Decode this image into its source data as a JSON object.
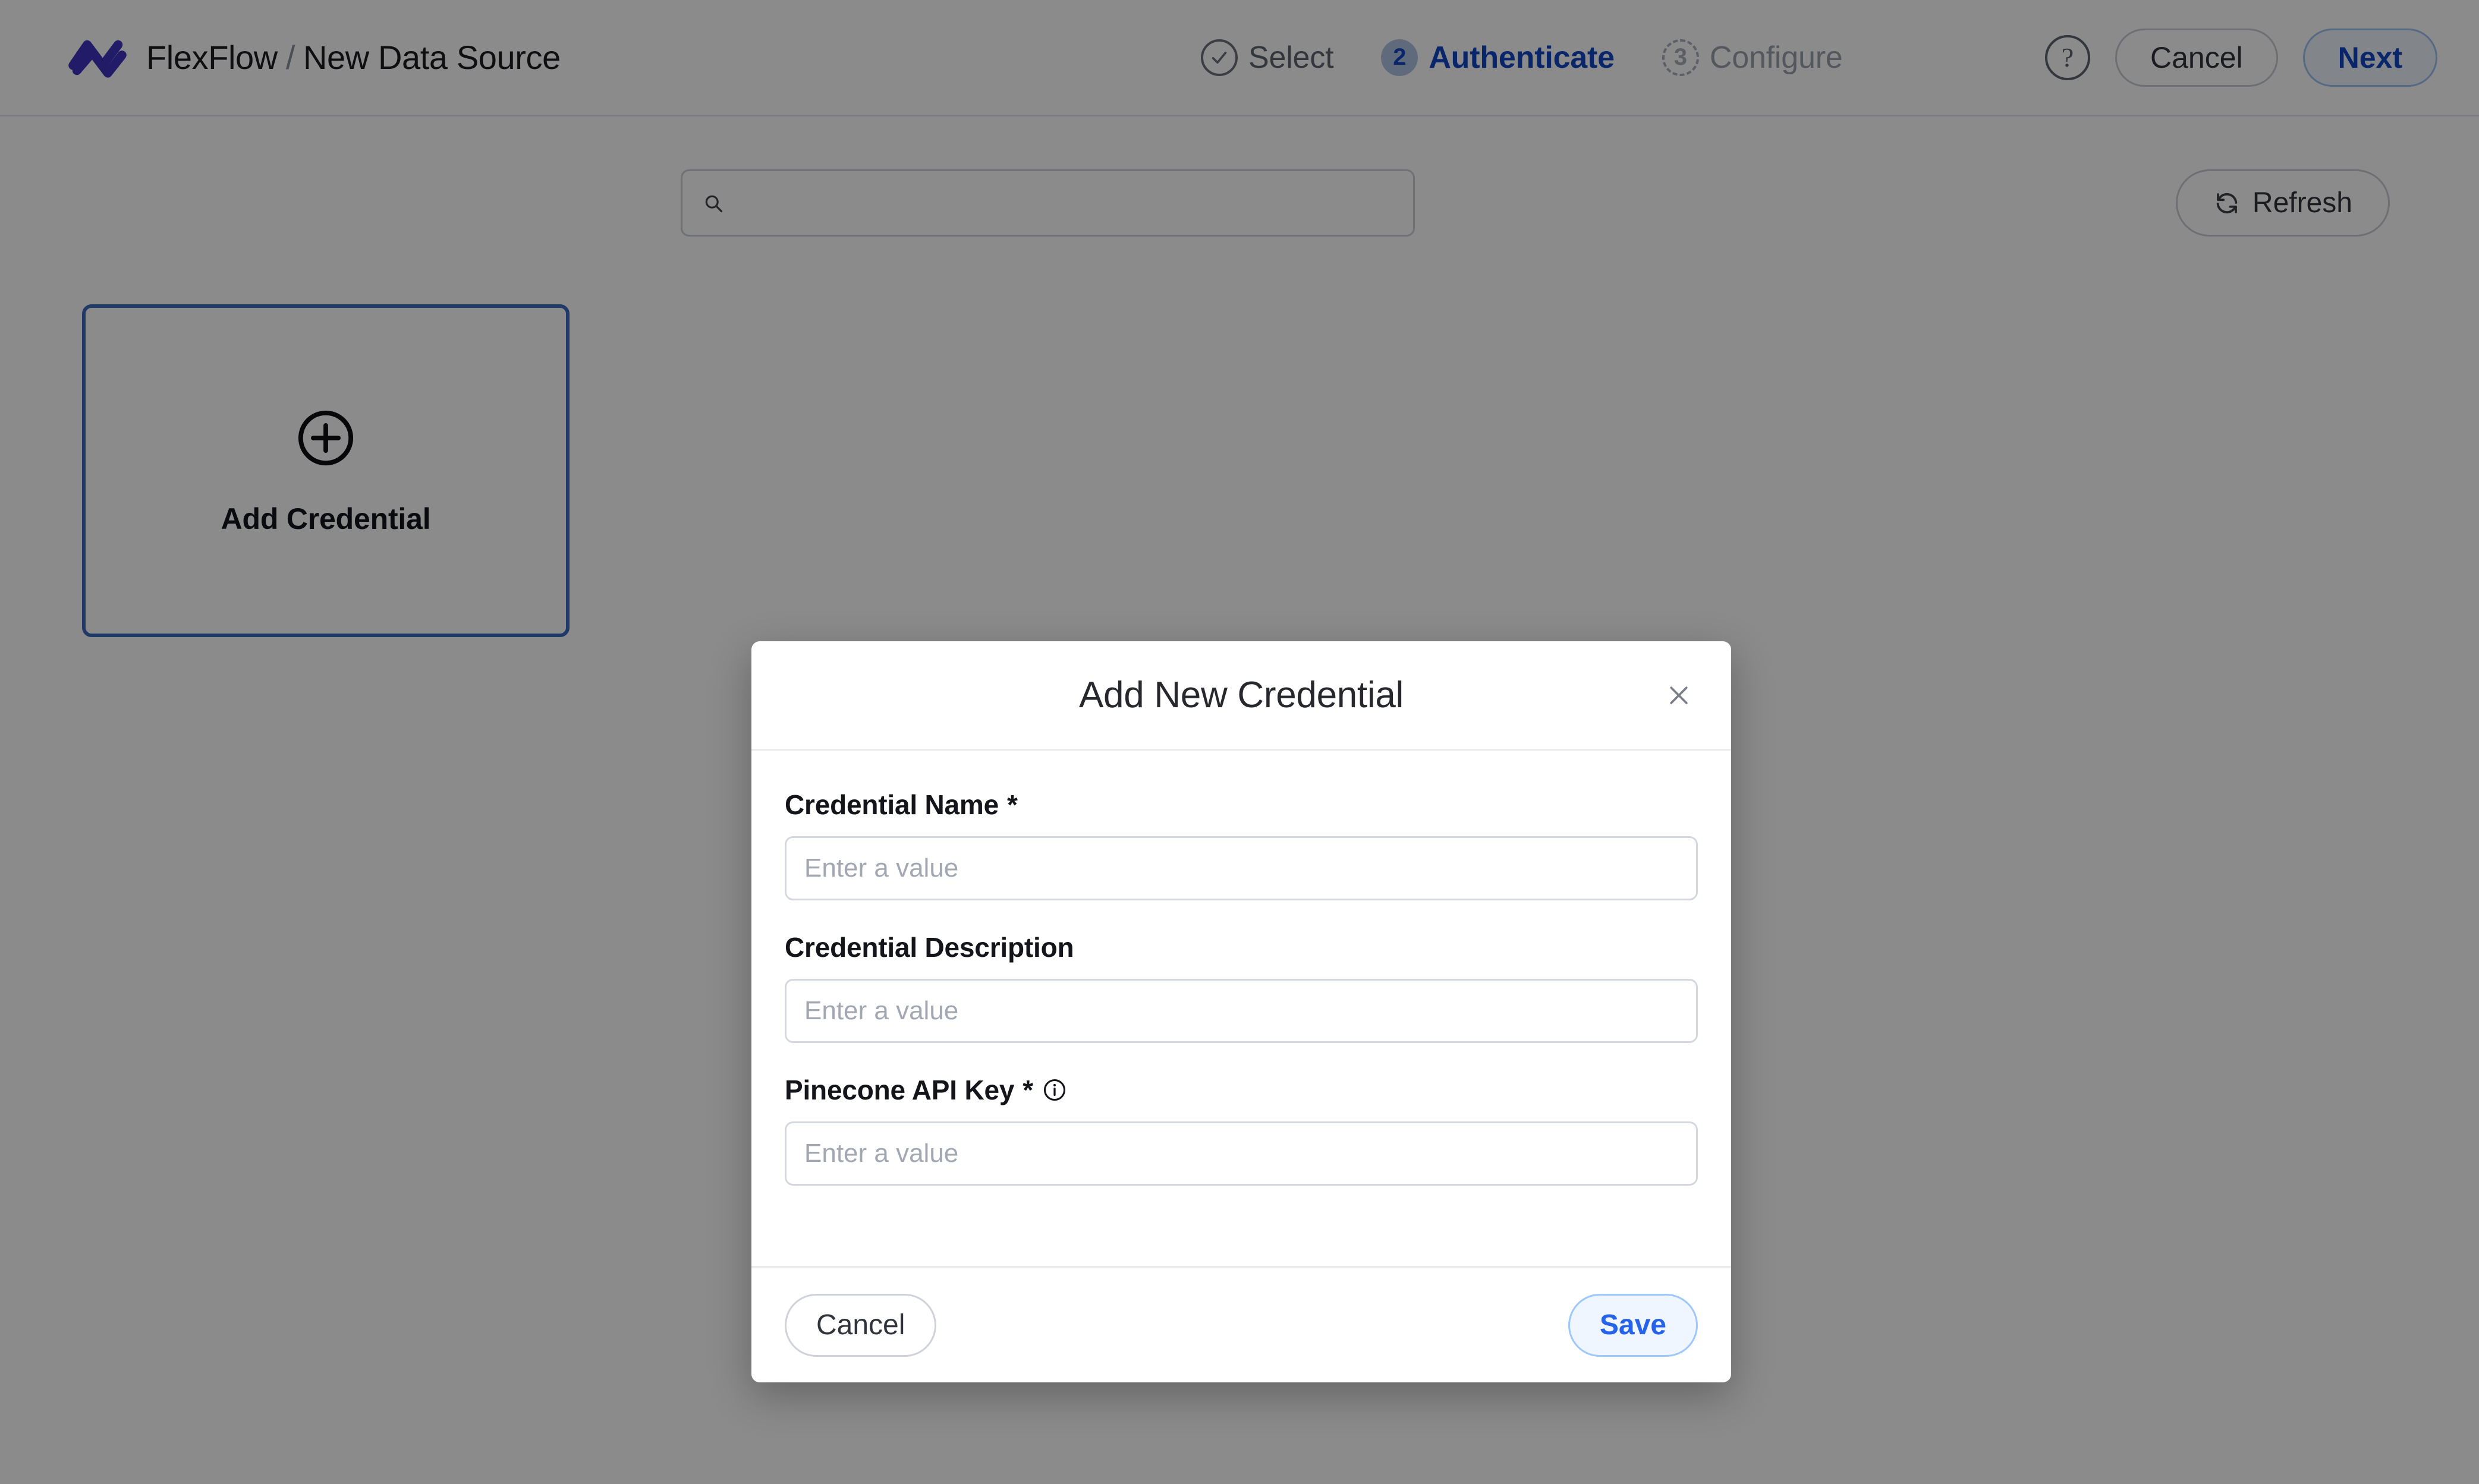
{
  "header": {
    "logo_icon": "flexflow-zigzag-logo",
    "brand": "FlexFlow",
    "separator": "/",
    "page_title": "New Data Source",
    "steps": [
      {
        "marker": "check",
        "number": "",
        "label": "Select",
        "state": "done"
      },
      {
        "marker": "number",
        "number": "2",
        "label": "Authenticate",
        "state": "active"
      },
      {
        "marker": "number",
        "number": "3",
        "label": "Configure",
        "state": "todo"
      }
    ],
    "help_glyph": "?",
    "cancel_label": "Cancel",
    "next_label": "Next"
  },
  "toolbar": {
    "search": {
      "icon": "search-icon",
      "value": "",
      "placeholder": ""
    },
    "refresh_label": "Refresh",
    "refresh_icon": "refresh-icon"
  },
  "content": {
    "add_credential": {
      "icon": "plus-circle-icon",
      "label": "Add Credential"
    }
  },
  "modal": {
    "title": "Add New Credential",
    "close_icon": "close-icon",
    "fields": [
      {
        "label": "Credential Name",
        "required": true,
        "required_marker": "*",
        "has_info": false,
        "value": "",
        "placeholder": "Enter a value"
      },
      {
        "label": "Credential Description",
        "required": false,
        "required_marker": "",
        "has_info": false,
        "value": "",
        "placeholder": "Enter a value"
      },
      {
        "label": "Pinecone API Key",
        "required": true,
        "required_marker": "*",
        "has_info": true,
        "info_icon": "info-circle-icon",
        "value": "",
        "placeholder": "Enter a value"
      }
    ],
    "cancel_label": "Cancel",
    "save_label": "Save"
  },
  "colors": {
    "brand_logo": "#3f35bf",
    "accent_blue": "#2563eb",
    "step_active_text": "#1447c4",
    "step_active_badge": "#aec4e4",
    "card_border": "#3b6bbf",
    "overlay": "rgba(0,0,0,0.455)"
  }
}
